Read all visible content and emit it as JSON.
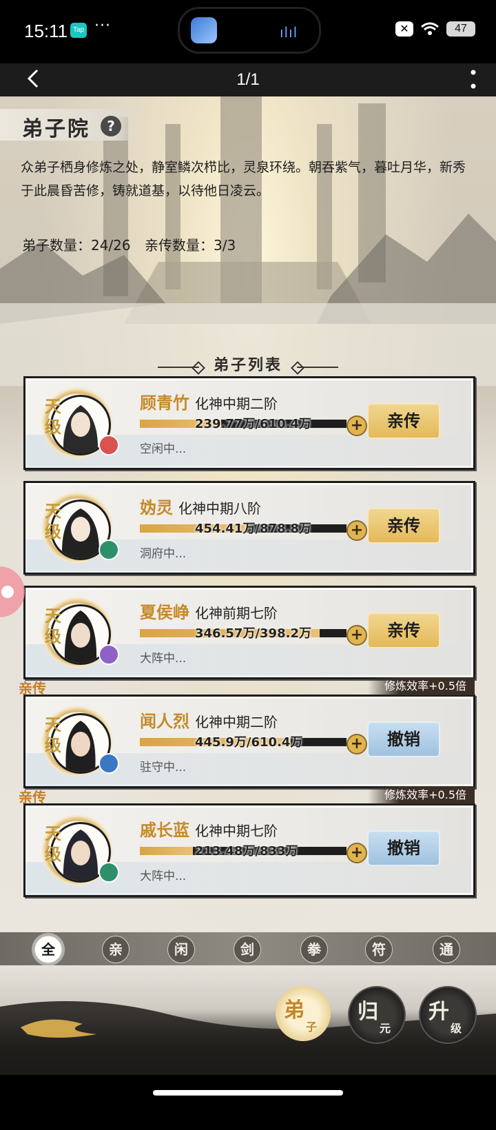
{
  "status_bar": {
    "time": "15:11",
    "app_badge": "Tap",
    "more": "···",
    "battery": "47"
  },
  "nav": {
    "page_indicator": "1/1"
  },
  "header": {
    "title": "弟子院",
    "help": "?",
    "description": "众弟子栖身修炼之处，静室鳞次栉比，灵泉环绕。朝吞紫气，暮吐月华，新秀于此晨昏苦修，铸就道基，以待他日凌云。",
    "disciple_count": "弟子数量：24/26",
    "direct_count": "亲传数量：3/3"
  },
  "list_title": "弟子列表",
  "disciples": [
    {
      "grade": "天级",
      "name": "顾青竹",
      "realm": "化神中期二阶",
      "progress_text": "239.77万/610.4万",
      "progress": 0.393,
      "activity": "空闲中...",
      "action": "亲传",
      "element_color": "#d9534f",
      "tag": "",
      "effect": ""
    },
    {
      "grade": "天级",
      "name": "妫灵",
      "realm": "化神中期八阶",
      "progress_text": "454.41万/878.8万",
      "progress": 0.517,
      "activity": "洞府中...",
      "action": "亲传",
      "element_color": "#2f8f6a",
      "tag": "",
      "effect": ""
    },
    {
      "grade": "天级",
      "name": "夏侯峥",
      "realm": "化神前期七阶",
      "progress_text": "346.57万/398.2万",
      "progress": 0.87,
      "activity": "大阵中...",
      "action": "亲传",
      "element_color": "#8e62c4",
      "tag": "",
      "effect": ""
    },
    {
      "grade": "天级",
      "name": "闻人烈",
      "realm": "化神中期二阶",
      "progress_text": "445.9万/610.4万",
      "progress": 0.73,
      "activity": "驻守中...",
      "action": "撤销",
      "element_color": "#3b78c2",
      "tag": "亲传",
      "effect": "修炼效率+0.5倍"
    },
    {
      "grade": "天级",
      "name": "戚长蓝",
      "realm": "化神中期七阶",
      "progress_text": "213.48万/833万",
      "progress": 0.256,
      "activity": "大阵中...",
      "action": "撤销",
      "element_color": "#2f8f6a",
      "tag": "亲传",
      "effect": "修炼效率+0.5倍"
    }
  ],
  "filters": [
    "全",
    "亲",
    "闲",
    "剑",
    "拳",
    "符",
    "通"
  ],
  "bottom_buttons": [
    {
      "main": "弟",
      "sub": "子"
    },
    {
      "main": "归",
      "sub": "元"
    },
    {
      "main": "升",
      "sub": "级"
    }
  ]
}
